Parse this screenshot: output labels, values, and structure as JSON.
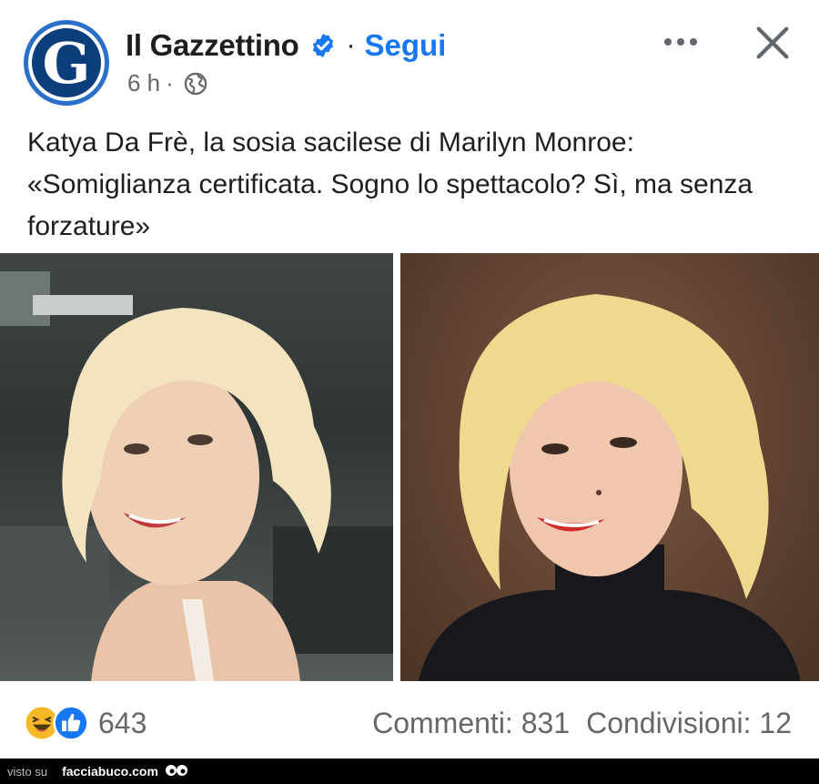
{
  "post": {
    "page_name": "Il Gazzettino",
    "avatar_letter": "G",
    "follow_label": "Segui",
    "separator": "·",
    "time": "6 h",
    "caption": "Katya Da Frè, la sosia sacilese di Marilyn Monroe: «Somiglianza certificata. Sogno lo spettacolo? Sì, ma senza forzature»",
    "icons": {
      "verified": "verified-badge-icon",
      "audience": "globe-icon",
      "more": "more-options-icon",
      "close": "close-icon"
    }
  },
  "photos": [
    {
      "name": "photo-left",
      "description_icon": "portrait-photo"
    },
    {
      "name": "photo-right",
      "description_icon": "portrait-photo"
    }
  ],
  "footer": {
    "reactions": [
      "haha",
      "like"
    ],
    "reaction_count": "643",
    "comments": "Commenti: 831",
    "shares": "Condivisioni: 12"
  },
  "watermark": {
    "prefix": "visto su",
    "site": "facciabuco.com"
  },
  "colors": {
    "accent": "#1877f2",
    "text": "#1c1e21",
    "muted": "#65676b",
    "brand_blue": "#0d3e7c"
  }
}
